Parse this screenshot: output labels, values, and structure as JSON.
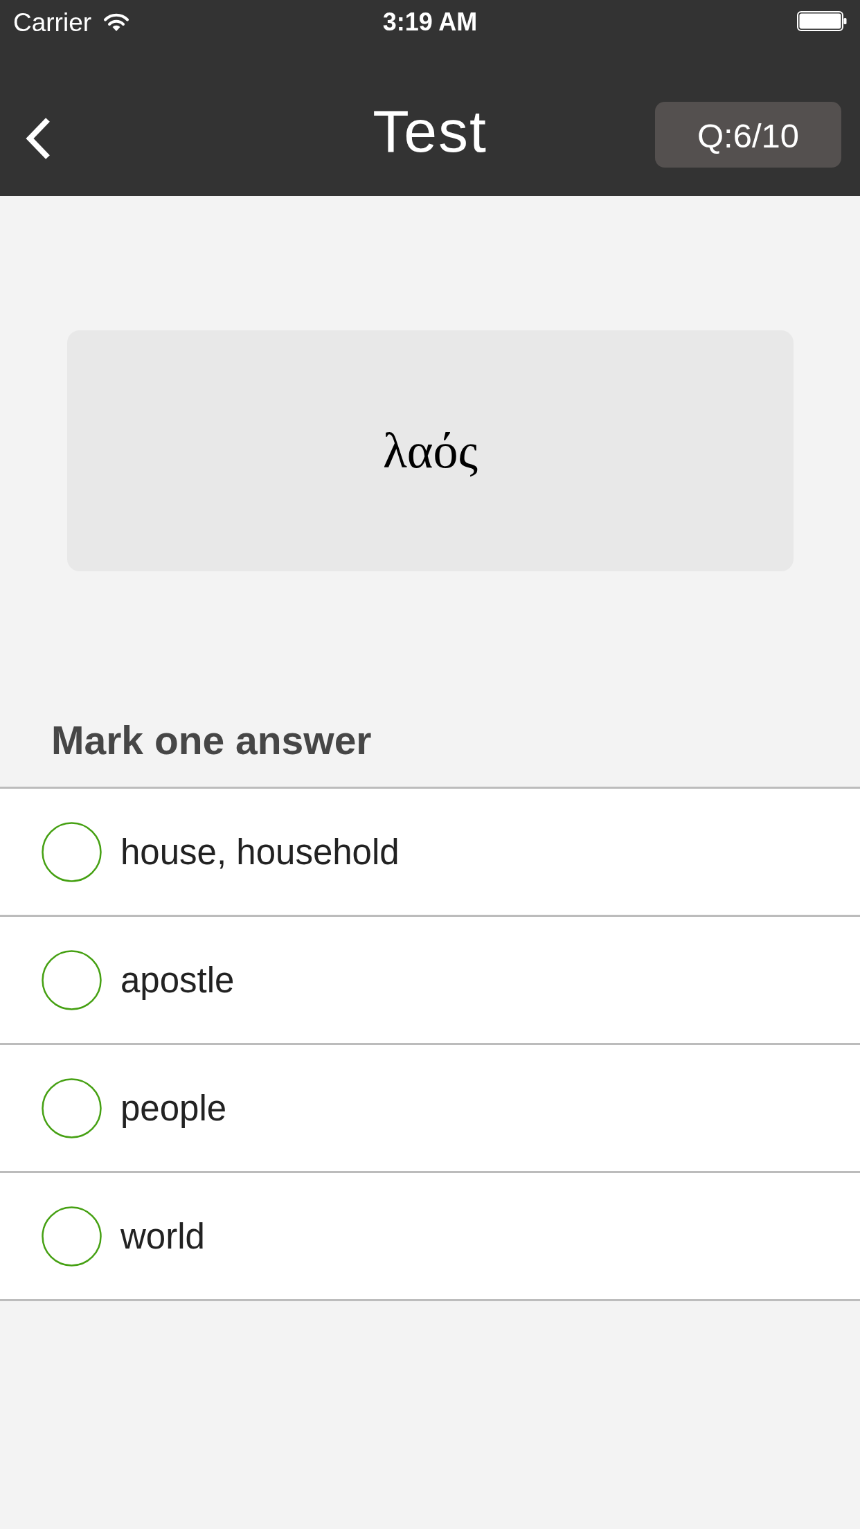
{
  "status_bar": {
    "carrier": "Carrier",
    "time": "3:19 AM"
  },
  "nav_bar": {
    "title": "Test",
    "progress": "Q:6/10"
  },
  "question": {
    "word": "λαός"
  },
  "answers": {
    "heading": "Mark one answer",
    "options": [
      {
        "label": "house, household",
        "selected": false
      },
      {
        "label": "apostle",
        "selected": false
      },
      {
        "label": "people",
        "selected": false
      },
      {
        "label": "world",
        "selected": false
      }
    ]
  }
}
